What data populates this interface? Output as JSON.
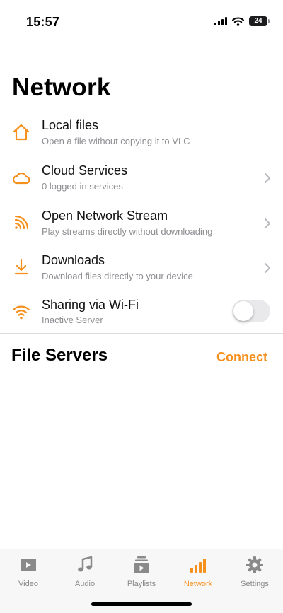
{
  "status_bar": {
    "time": "15:57",
    "battery": "24"
  },
  "page": {
    "title": "Network"
  },
  "menu": [
    {
      "title": "Local files",
      "subtitle": "Open a file without copying it to VLC",
      "icon": "house-icon",
      "chevron": false
    },
    {
      "title": "Cloud Services",
      "subtitle": "0 logged in services",
      "icon": "cloud-icon",
      "chevron": true
    },
    {
      "title": "Open Network Stream",
      "subtitle": "Play streams directly without downloading",
      "icon": "rss-icon",
      "chevron": true
    },
    {
      "title": "Downloads",
      "subtitle": "Download files directly to your device",
      "icon": "download-icon",
      "chevron": true
    },
    {
      "title": "Sharing via Wi-Fi",
      "subtitle": "Inactive Server",
      "icon": "wifi-icon",
      "toggle": false
    }
  ],
  "file_servers": {
    "title": "File Servers",
    "connect_label": "Connect"
  },
  "tabs": [
    {
      "label": "Video",
      "icon": "video-icon",
      "active": false
    },
    {
      "label": "Audio",
      "icon": "music-note-icon",
      "active": false
    },
    {
      "label": "Playlists",
      "icon": "playlist-icon",
      "active": false
    },
    {
      "label": "Network",
      "icon": "network-bars-icon",
      "active": true
    },
    {
      "label": "Settings",
      "icon": "gear-icon",
      "active": false
    }
  ],
  "colors": {
    "accent": "#f5901d",
    "secondary_text": "#8e8e93",
    "inactive_tab": "#8a8a8a",
    "divider": "#dcdcdc"
  }
}
